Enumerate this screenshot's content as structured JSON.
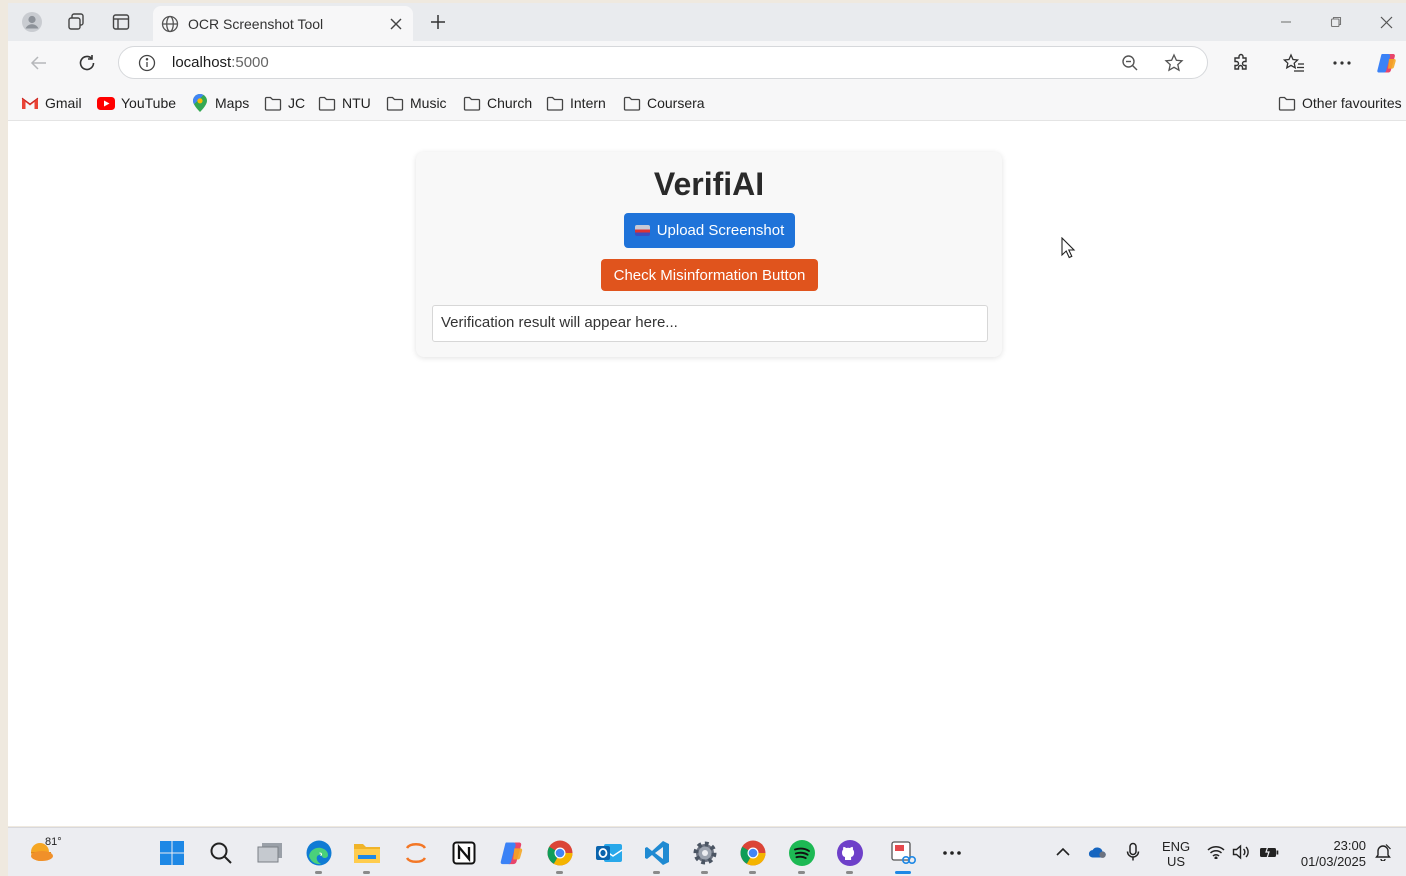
{
  "browser": {
    "tab_title": "OCR Screenshot Tool",
    "url_host": "localhost",
    "url_port": ":5000"
  },
  "favourites": [
    {
      "label": "Gmail",
      "icon": "gmail-icon"
    },
    {
      "label": "YouTube",
      "icon": "youtube-icon"
    },
    {
      "label": "Maps",
      "icon": "maps-icon"
    },
    {
      "label": "JC",
      "icon": "folder-icon"
    },
    {
      "label": "NTU",
      "icon": "folder-icon"
    },
    {
      "label": "Music",
      "icon": "folder-icon"
    },
    {
      "label": "Church",
      "icon": "folder-icon"
    },
    {
      "label": "Intern",
      "icon": "folder-icon"
    },
    {
      "label": "Coursera",
      "icon": "folder-icon"
    }
  ],
  "other_favourites": "Other favourites",
  "page": {
    "title": "VerifiAI",
    "upload_label": "Upload Screenshot",
    "check_label": "Check Misinformation Button",
    "result_placeholder": "Verification result will appear here..."
  },
  "colors": {
    "upload_button": "#1f73d9",
    "check_button": "#e0541d"
  },
  "taskbar": {
    "weather_temp": "81°",
    "lang_primary": "ENG",
    "lang_secondary": "US",
    "time": "23:00",
    "date": "01/03/2025"
  }
}
